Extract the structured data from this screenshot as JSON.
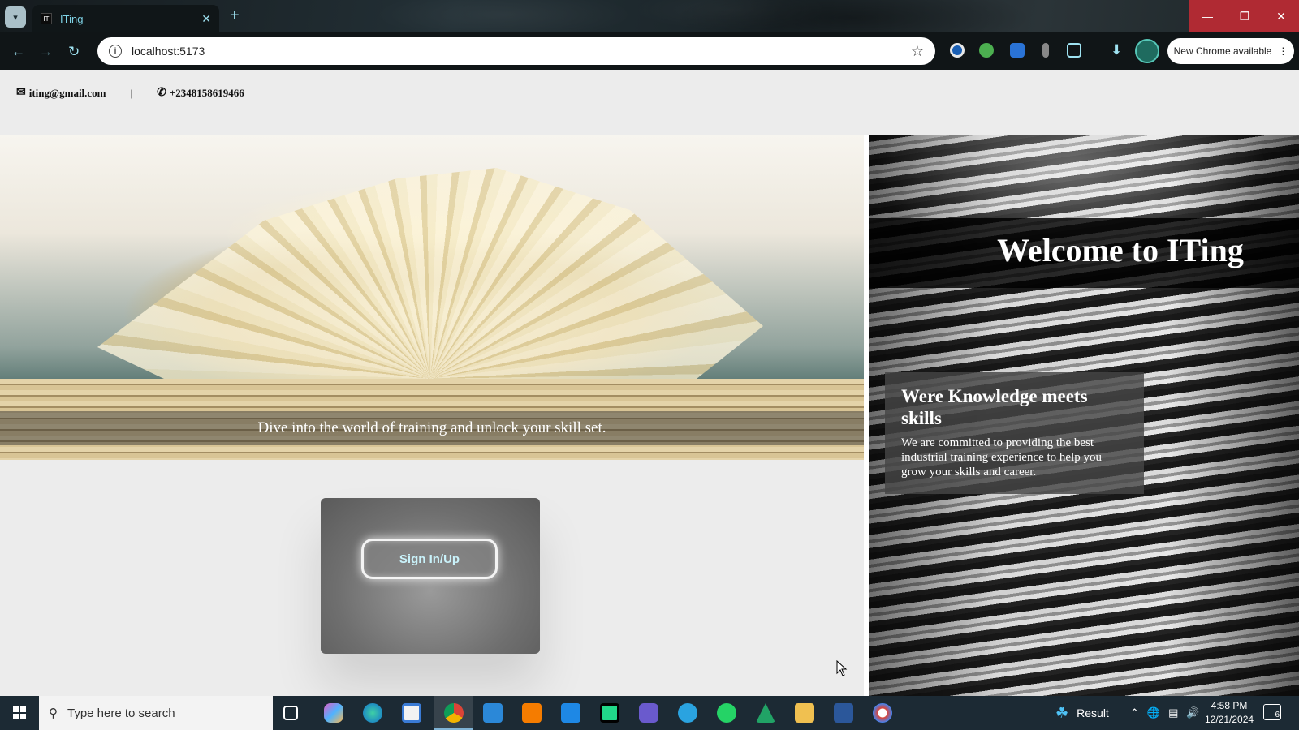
{
  "browser": {
    "tab_title": "ITing",
    "tab_favicon": "IT",
    "url": "localhost:5173",
    "update_label": "New Chrome available"
  },
  "contact": {
    "email": "iting@gmail.com",
    "separator": "|",
    "phone": "+2348158619466"
  },
  "hero": {
    "caption": "Dive into the world of training and unlock your skill set."
  },
  "signin": {
    "label": "Sign In/Up"
  },
  "right_panel": {
    "welcome": "Welcome to ITing",
    "card_title": "Were Knowledge meets skills",
    "card_text": "We are committed to providing the best industrial training experience to help you grow your skills and career."
  },
  "taskbar": {
    "search_placeholder": "Type here to search",
    "weather_label": "Result",
    "time": "4:58 PM",
    "date": "12/21/2024",
    "notification_count": "6"
  },
  "colors": {
    "accent_cyan": "#9fe3f2",
    "close_red": "#b02a33",
    "taskbar": "#1c2a34"
  }
}
